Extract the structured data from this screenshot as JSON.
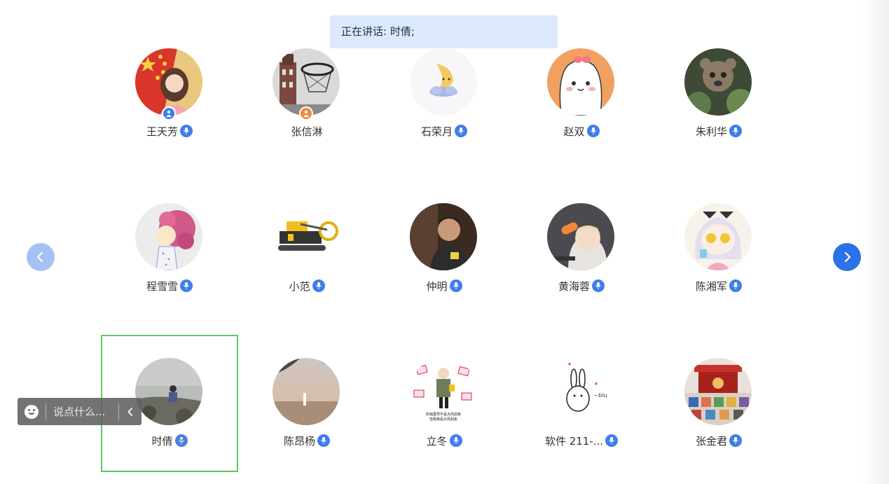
{
  "banner": {
    "text": "正在讲话: 时倩;"
  },
  "navigation": {
    "prev_icon": "chevron-left-icon",
    "next_icon": "chevron-right-icon"
  },
  "participants": [
    {
      "name": "王天芳",
      "avatar": "flag-girl",
      "badge": "host-blue",
      "mic": "mic-icon"
    },
    {
      "name": "张信淋",
      "avatar": "basketball-tower",
      "badge": "cohost-orange",
      "mic": ""
    },
    {
      "name": "石荣月",
      "avatar": "moon-cloud",
      "badge": "",
      "mic": "mic-icon"
    },
    {
      "name": "赵双",
      "avatar": "bunny-bow",
      "badge": "",
      "mic": "mic-icon"
    },
    {
      "name": "朱利华",
      "avatar": "bear-plants",
      "badge": "",
      "mic": "mic-icon"
    },
    {
      "name": "程雪雪",
      "avatar": "curly-girl",
      "badge": "",
      "mic": "mic-icon"
    },
    {
      "name": "小范",
      "avatar": "excavator",
      "badge": "",
      "mic": "mic-icon"
    },
    {
      "name": "仲明",
      "avatar": "boy-photo",
      "badge": "",
      "mic": "mic-icon"
    },
    {
      "name": "黄海蓉",
      "avatar": "baby-bottle",
      "badge": "",
      "mic": "mic-icon"
    },
    {
      "name": "陈湘军",
      "avatar": "anime-girl",
      "badge": "",
      "mic": "mic-icon"
    },
    {
      "name": "时倩",
      "avatar": "sea-rock",
      "badge": "",
      "mic": "mic-active-icon",
      "active": true
    },
    {
      "name": "陈昂杨",
      "avatar": "sunset-lake",
      "badge": "",
      "mic": "mic-icon"
    },
    {
      "name": "立冬",
      "avatar": "child-poster",
      "badge": "",
      "mic": "mic-icon"
    },
    {
      "name": "软件 211-...",
      "avatar": "rabbit-biu",
      "badge": "",
      "mic": "mic-icon"
    },
    {
      "name": "张金君",
      "avatar": "temple-gate",
      "badge": "",
      "mic": "mic-icon"
    }
  ],
  "avatar_texts": {
    "rabbit": "~biu",
    "poster": "的钱虽然不是大风刮来\n但看像是大风刮走"
  },
  "chat": {
    "placeholder": "说点什么...",
    "emoji_icon": "smile-icon",
    "collapse_icon": "chevron-left-icon"
  },
  "colors": {
    "accent": "#2b72e8",
    "banner_bg": "#dce8fb",
    "active_outline": "#5fc763"
  }
}
